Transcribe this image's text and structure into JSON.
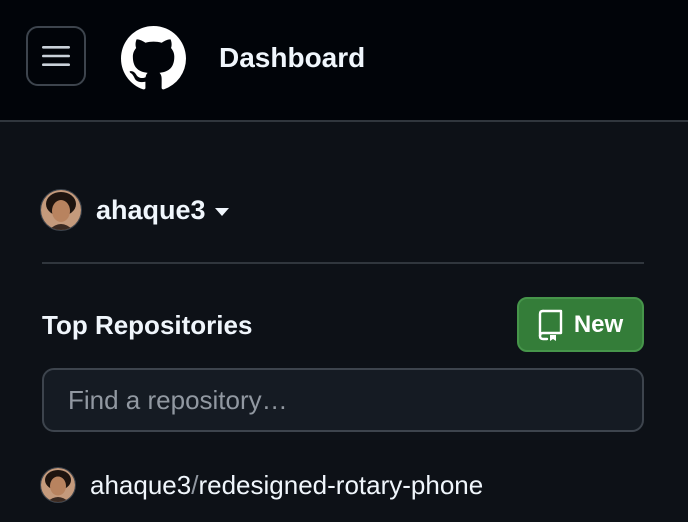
{
  "header": {
    "title": "Dashboard",
    "menu_icon": "hamburger-menu-icon",
    "logo_icon": "github-octocat-icon"
  },
  "account": {
    "username": "ahaque3",
    "caret_icon": "triangle-down-icon"
  },
  "repositories": {
    "title": "Top Repositories",
    "new_button_label": "New",
    "new_button_icon": "repo-icon",
    "search_placeholder": "Find a repository…",
    "search_value": "",
    "items": [
      {
        "owner": "ahaque3",
        "separator": "/",
        "name": "redesigned-rotary-phone"
      }
    ]
  },
  "colors": {
    "background": "#0d1117",
    "header_background": "#010409",
    "border": "#30363d",
    "primary_button": "#347d39",
    "text": "#f0f6fc",
    "muted_text": "#9198a1"
  }
}
